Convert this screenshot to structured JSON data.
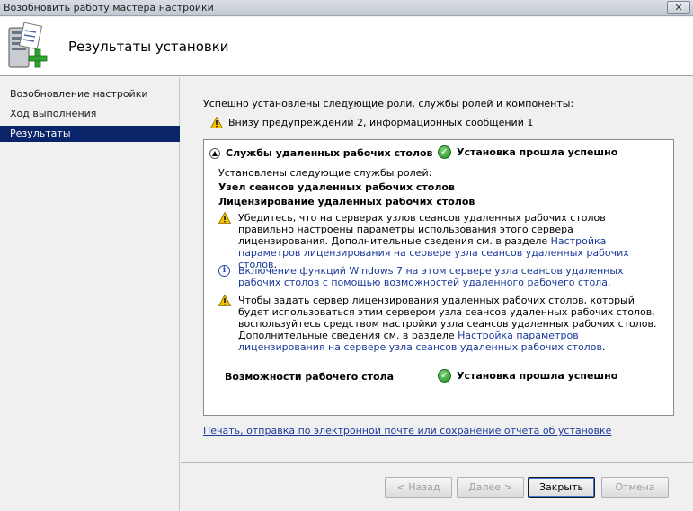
{
  "window": {
    "title": "Возобновить работу мастера настройки",
    "close_label": "✕"
  },
  "header": {
    "title": "Результаты установки",
    "icon": "server-install-icon"
  },
  "sidebar": {
    "items": [
      {
        "label": "Возобновление настройки",
        "active": false
      },
      {
        "label": "Ход выполнения",
        "active": false
      },
      {
        "label": "Результаты",
        "active": true
      }
    ]
  },
  "main": {
    "intro": "Успешно установлены следующие роли, службы ролей и компоненты:",
    "warning_summary": "Внизу предупреждений 2, информационных сообщений 1",
    "role": {
      "name": "Службы удаленных рабочих столов",
      "status": "Установка прошла успешно",
      "services_intro": "Установлены следующие службы ролей:",
      "services": [
        "Узел сеансов удаленных рабочих столов",
        "Лицензирование удаленных рабочих столов"
      ],
      "messages": [
        {
          "type": "warning",
          "text": "Убедитесь, что на серверах узлов сеансов удаленных рабочих столов правильно настроены параметры использования этого сервера лицензирования. Дополнительные сведения см. в разделе ",
          "link": "Настройка параметров лицензирования на сервере узла сеансов удаленных рабочих столов",
          "tail": "."
        },
        {
          "type": "info",
          "text": "",
          "link": "Включение функций Windows 7 на этом сервере узла сеансов удаленных рабочих столов с помощью возможностей удаленного рабочего стола",
          "tail": "."
        },
        {
          "type": "warning",
          "text": "Чтобы задать сервер лицензирования удаленных рабочих столов, который будет использоваться этим сервером узла сеансов удаленных рабочих столов, воспользуйтесь средством настройки узла сеансов удаленных рабочих столов. Дополнительные сведения см. в разделе ",
          "link": "Настройка параметров лицензирования на сервере узла сеансов удаленных рабочих столов",
          "tail": "."
        }
      ]
    },
    "feature": {
      "name": "Возможности рабочего стола",
      "status": "Установка прошла успешно"
    },
    "report_link": "Печать, отправка по электронной почте или сохранение отчета об установке"
  },
  "buttons": {
    "back": "< Назад",
    "next": "Далее >",
    "close": "Закрыть",
    "cancel": "Отмена"
  }
}
